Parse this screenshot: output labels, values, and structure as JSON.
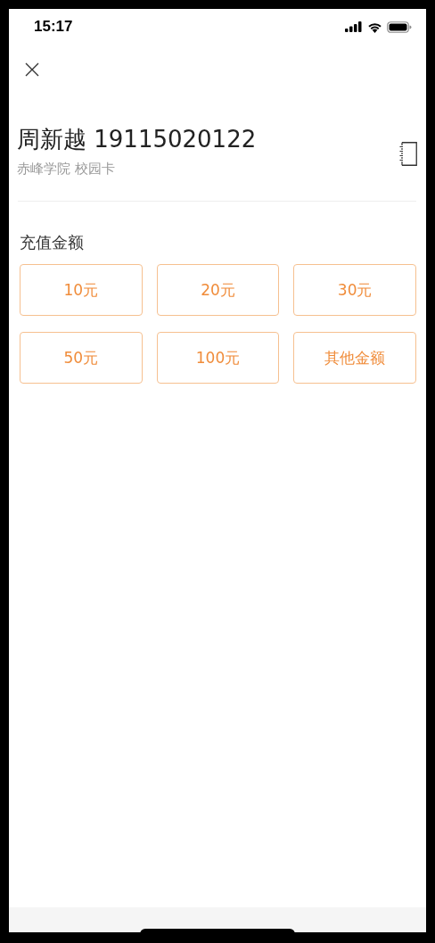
{
  "status_bar": {
    "time": "15:17"
  },
  "card": {
    "title": "周新越 19115020122",
    "subtitle": "赤峰学院 校园卡"
  },
  "recharge": {
    "label": "充值金额",
    "amounts": [
      {
        "label": "10元",
        "selected": false
      },
      {
        "label": "20元",
        "selected": false
      },
      {
        "label": "30元",
        "selected": false
      },
      {
        "label": "50元",
        "selected": false
      },
      {
        "label": "100元",
        "selected": false
      },
      {
        "label": "其他金额",
        "selected": false
      }
    ]
  }
}
